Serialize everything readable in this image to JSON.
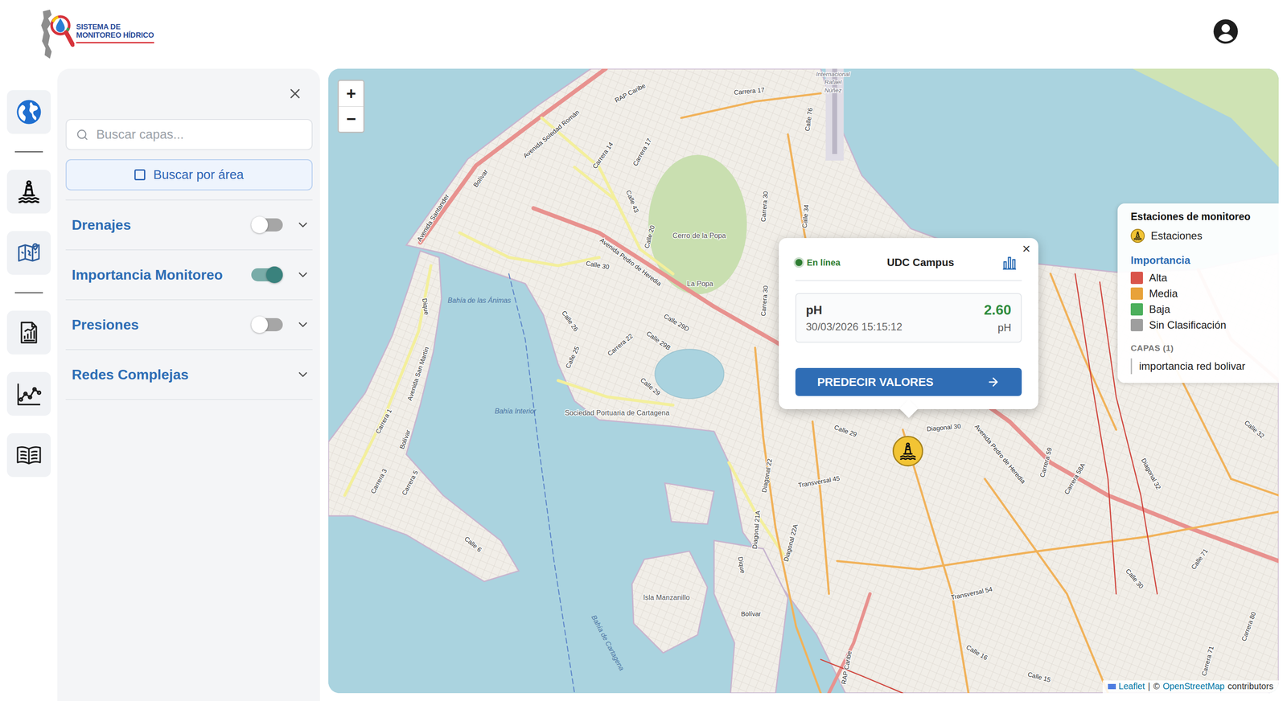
{
  "header": {
    "logo": {
      "line1": "SISTEMA DE",
      "line2": "MONITOREO HÍDRICO"
    }
  },
  "layers_panel": {
    "search": {
      "placeholder": "Buscar capas..."
    },
    "area_button": {
      "label": "Buscar por área",
      "checked": false
    },
    "layers": [
      {
        "name": "Drenajes",
        "kind": "toggle",
        "on": false,
        "expanded": false
      },
      {
        "name": "Importancia Monitoreo",
        "kind": "toggle",
        "on": true,
        "expanded": false
      },
      {
        "name": "Presiones",
        "kind": "toggle",
        "on": false,
        "expanded": false
      },
      {
        "name": "Redes Complejas",
        "kind": "group",
        "expanded": false
      }
    ]
  },
  "map": {
    "zoom": {
      "in": "+",
      "out": "−"
    },
    "labels": [
      {
        "text": "Internacional",
        "kind": "poi"
      },
      {
        "text": "Rafael",
        "kind": "poi"
      },
      {
        "text": "Núñez",
        "kind": "poi"
      },
      {
        "text": "Carrera 17",
        "kind": "street"
      },
      {
        "text": "RAP Caribe",
        "kind": "street"
      },
      {
        "text": "Avenida Soledad Román",
        "kind": "street"
      },
      {
        "text": "Carrera 14",
        "kind": "street"
      },
      {
        "text": "Carrera 17",
        "kind": "street"
      },
      {
        "text": "Calle 76",
        "kind": "street"
      },
      {
        "text": "Bolívar",
        "kind": "street"
      },
      {
        "text": "Avenida Santander",
        "kind": "street"
      },
      {
        "text": "Calle 43",
        "kind": "street"
      },
      {
        "text": "Calle 20",
        "kind": "street"
      },
      {
        "text": "Cerro de la Popa",
        "kind": "place"
      },
      {
        "text": "La Popa",
        "kind": "place"
      },
      {
        "text": "Avenida Pedro de Heredia",
        "kind": "street"
      },
      {
        "text": "Carrera 30",
        "kind": "street"
      },
      {
        "text": "Calle 34",
        "kind": "street"
      },
      {
        "text": "Carrera 30",
        "kind": "street"
      },
      {
        "text": "Calle 30",
        "kind": "street"
      },
      {
        "text": "Calle 29D",
        "kind": "street"
      },
      {
        "text": "Calle 29B",
        "kind": "street"
      },
      {
        "text": "Calle 29",
        "kind": "street"
      },
      {
        "text": "Carrera 22",
        "kind": "street"
      },
      {
        "text": "Calle 26",
        "kind": "street"
      },
      {
        "text": "Calle 25",
        "kind": "street"
      },
      {
        "text": "Bahía de las Ánimas",
        "kind": "water"
      },
      {
        "text": "Avenida San Martín",
        "kind": "street"
      },
      {
        "text": "Carrera 1",
        "kind": "street"
      },
      {
        "text": "Bolívar",
        "kind": "street"
      },
      {
        "text": "Dique",
        "kind": "street"
      },
      {
        "text": "Carrera 3",
        "kind": "street"
      },
      {
        "text": "Carrera 5",
        "kind": "street"
      },
      {
        "text": "Calle 6",
        "kind": "street"
      },
      {
        "text": "Bahía Interior",
        "kind": "water"
      },
      {
        "text": "Sociedad Portuaria de Cartagena",
        "kind": "place"
      },
      {
        "text": "Diagonal 22",
        "kind": "street"
      },
      {
        "text": "Diagonal 21A",
        "kind": "street"
      },
      {
        "text": "Diagonal 22A",
        "kind": "street"
      },
      {
        "text": "Transversal 45",
        "kind": "street"
      },
      {
        "text": "Calle 29",
        "kind": "street"
      },
      {
        "text": "Diagonal 30",
        "kind": "street"
      },
      {
        "text": "Avenida Pedro de Heredia",
        "kind": "street"
      },
      {
        "text": "Carrera 59",
        "kind": "street"
      },
      {
        "text": "Carrera 58A",
        "kind": "street"
      },
      {
        "text": "Diagonal 32",
        "kind": "street"
      },
      {
        "text": "Calle 32",
        "kind": "street"
      },
      {
        "text": "Isla Manzanillo",
        "kind": "place"
      },
      {
        "text": "Bolívar",
        "kind": "street"
      },
      {
        "text": "Dique",
        "kind": "street"
      },
      {
        "text": "Bahía de Cartagena",
        "kind": "water"
      },
      {
        "text": "Transversal 54",
        "kind": "street"
      },
      {
        "text": "Calle 30",
        "kind": "street"
      },
      {
        "text": "Calle 71",
        "kind": "street"
      },
      {
        "text": "Calle 16",
        "kind": "street"
      },
      {
        "text": "Calle 15",
        "kind": "street"
      },
      {
        "text": "Carrera 71",
        "kind": "street"
      },
      {
        "text": "Carrera 80",
        "kind": "street"
      },
      {
        "text": "RAP Caribe",
        "kind": "street"
      }
    ],
    "attribution": {
      "leaflet": "Leaflet",
      "separator": "|",
      "copyright": "©",
      "osm": "OpenStreetMap",
      "contributors": "contributors"
    }
  },
  "popup": {
    "status": "En línea",
    "online": true,
    "name": "UDC Campus",
    "close": "×",
    "reading": {
      "param": "pH",
      "time": "30/03/2026 15:15:12",
      "value": "2.60",
      "unit": "pH"
    },
    "button": "PREDECIR VALORES"
  },
  "legend": {
    "title": "Estaciones de monitoreo",
    "stations_label": "Estaciones",
    "importance_title": "Importancia",
    "levels": [
      {
        "label": "Alta",
        "color": "#d9544a"
      },
      {
        "label": "Media",
        "color": "#e8a23a"
      },
      {
        "label": "Baja",
        "color": "#4caf5c"
      },
      {
        "label": "Sin Clasificación",
        "color": "#9e9e9e"
      }
    ],
    "layers_title": "CAPAS (1)",
    "layers": [
      "importancia red bolivar"
    ]
  }
}
